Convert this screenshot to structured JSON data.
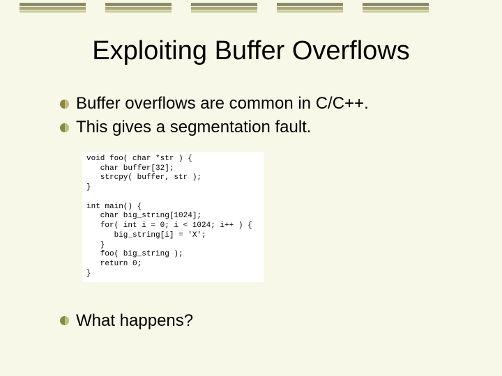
{
  "title": "Exploiting Buffer Overflows",
  "bullets": {
    "b1": "Buffer overflows are common in C/C++.",
    "b2": "This gives a segmentation fault.",
    "b3": "What happens?"
  },
  "code": "void foo( char *str ) {\n   char buffer[32];\n   strcpy( buffer, str );\n}\n\nint main() {\n   char big_string[1024];\n   for( int i = 0; i < 1024; i++ ) {\n      big_string[i] = 'X';\n   }\n   foo( big_string );\n   return 0;\n}"
}
